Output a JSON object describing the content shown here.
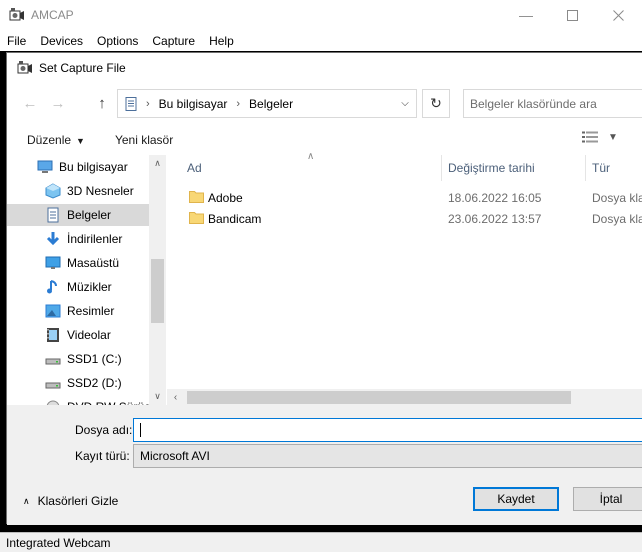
{
  "app": {
    "title": "AMCAP",
    "menu": [
      "File",
      "Devices",
      "Options",
      "Capture",
      "Help"
    ],
    "status": "Integrated Webcam"
  },
  "dialog": {
    "title": "Set Capture File",
    "breadcrumb": [
      "Bu bilgisayar",
      "Belgeler"
    ],
    "search_placeholder": "Belgeler klasöründe ara",
    "organize_label": "Düzenle",
    "new_folder_label": "Yeni klasör",
    "nav_items": [
      {
        "label": "Bu bilgisayar",
        "icon": "computer-icon",
        "selected": false
      },
      {
        "label": "3D Nesneler",
        "icon": "3d-objects-icon",
        "selected": false
      },
      {
        "label": "Belgeler",
        "icon": "documents-icon",
        "selected": true
      },
      {
        "label": "İndirilenler",
        "icon": "downloads-icon",
        "selected": false
      },
      {
        "label": "Masaüstü",
        "icon": "desktop-icon",
        "selected": false
      },
      {
        "label": "Müzikler",
        "icon": "music-icon",
        "selected": false
      },
      {
        "label": "Resimler",
        "icon": "pictures-icon",
        "selected": false
      },
      {
        "label": "Videolar",
        "icon": "videos-icon",
        "selected": false
      },
      {
        "label": "SSD1 (C:)",
        "icon": "drive-icon",
        "selected": false
      },
      {
        "label": "SSD2 (D:)",
        "icon": "drive-icon",
        "selected": false
      },
      {
        "label": "DVD RW Sürücü",
        "icon": "dvd-drive-icon",
        "selected": false
      }
    ],
    "columns": {
      "name": "Ad",
      "date": "Değiştirme tarihi",
      "type": "Tür"
    },
    "files": [
      {
        "name": "Adobe",
        "date": "18.06.2022 16:05",
        "type": "Dosya klasörü"
      },
      {
        "name": "Bandicam",
        "date": "23.06.2022 13:57",
        "type": "Dosya klasörü"
      }
    ],
    "filename_label": "Dosya adı:",
    "filename_value": "",
    "filetype_label": "Kayıt türü:",
    "filetype_value": "Microsoft AVI",
    "hide_folders_label": "Klasörleri Gizle",
    "save_label": "Kaydet",
    "cancel_label": "İptal"
  },
  "colors": {
    "accent": "#0078d7",
    "selection": "#d9d9d9",
    "folder": "#f8d775"
  }
}
